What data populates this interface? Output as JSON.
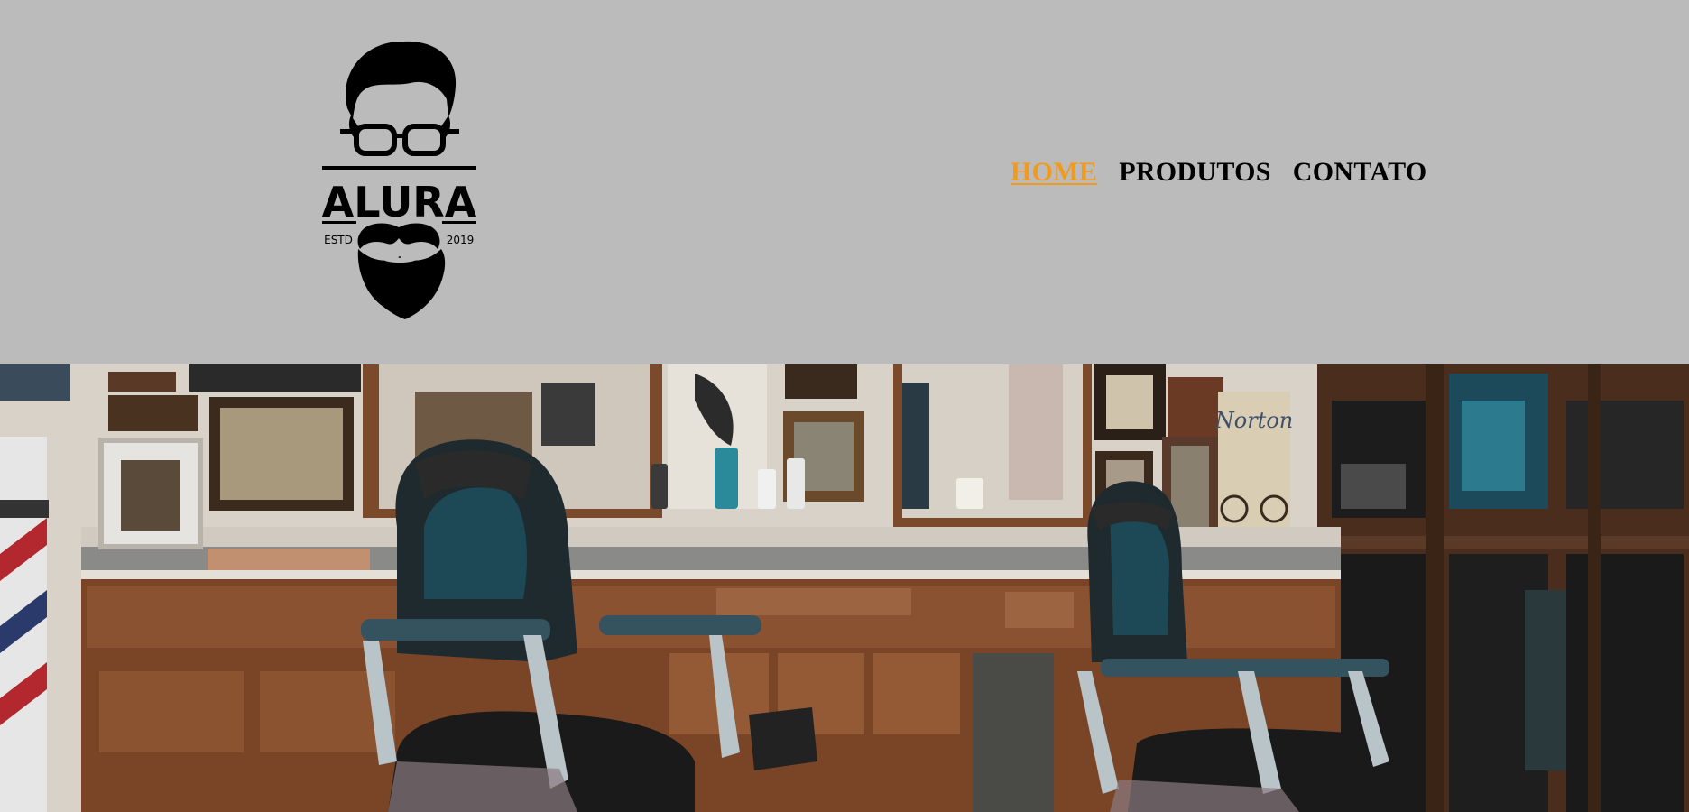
{
  "header": {
    "logo": {
      "brand_text": "ALURA",
      "left_tag": "ESTD",
      "right_tag": "2019",
      "icon": "bearded-man-glasses-logo"
    },
    "nav": {
      "items": [
        {
          "label": "HOME",
          "active": true
        },
        {
          "label": "PRODUTOS",
          "active": false
        },
        {
          "label": "CONTATO",
          "active": false
        }
      ]
    }
  },
  "hero": {
    "image": "barbershop-interior-photo",
    "poster_text": "Norton"
  },
  "colors": {
    "header_bg": "#bbbbbb",
    "nav_text": "#000000",
    "nav_active": "#f29a1e"
  }
}
